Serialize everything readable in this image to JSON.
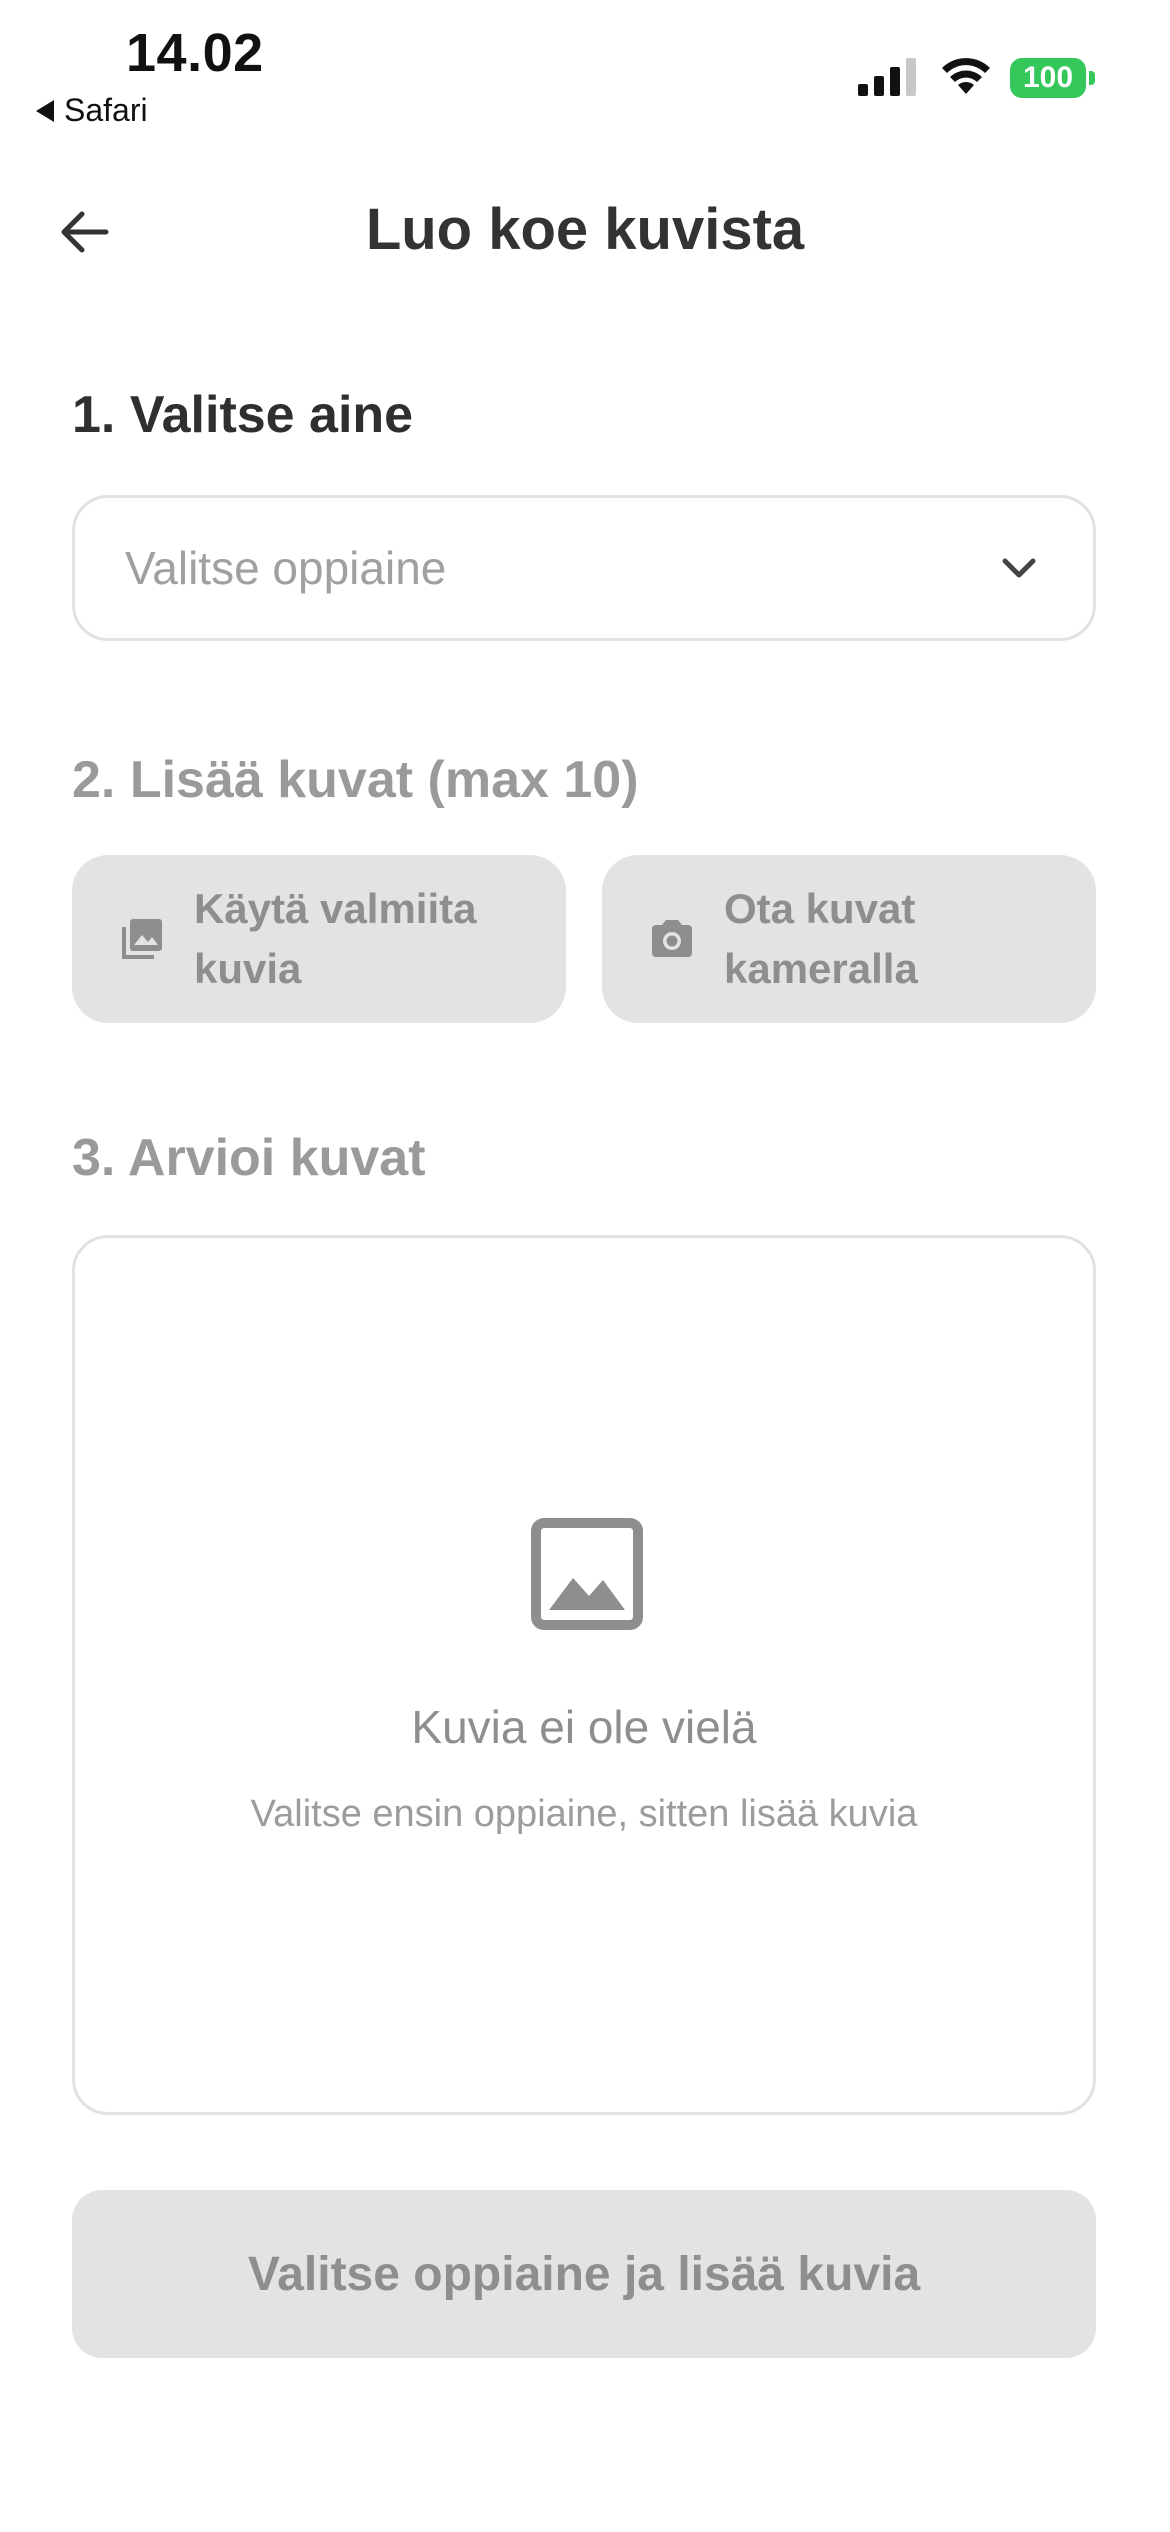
{
  "status_bar": {
    "time": "14.02",
    "back_app": "Safari",
    "battery": "100"
  },
  "header": {
    "title": "Luo koe kuvista"
  },
  "step1": {
    "title": "1. Valitse aine",
    "select_placeholder": "Valitse oppiaine"
  },
  "step2": {
    "title": "2. Lisää kuvat (max 10)",
    "gallery_button": "Käytä valmiita kuvia",
    "camera_button": "Ota kuvat kameralla"
  },
  "step3": {
    "title": "3. Arvioi kuvat",
    "empty_title": "Kuvia ei ole vielä",
    "empty_subtitle": "Valitse ensin oppiaine, sitten lisää kuvia"
  },
  "submit_button": "Valitse oppiaine ja lisää kuvia",
  "colors": {
    "battery": "#34c759",
    "disabled_bg": "#e3e3e3",
    "muted_text": "#9a9a9a"
  }
}
